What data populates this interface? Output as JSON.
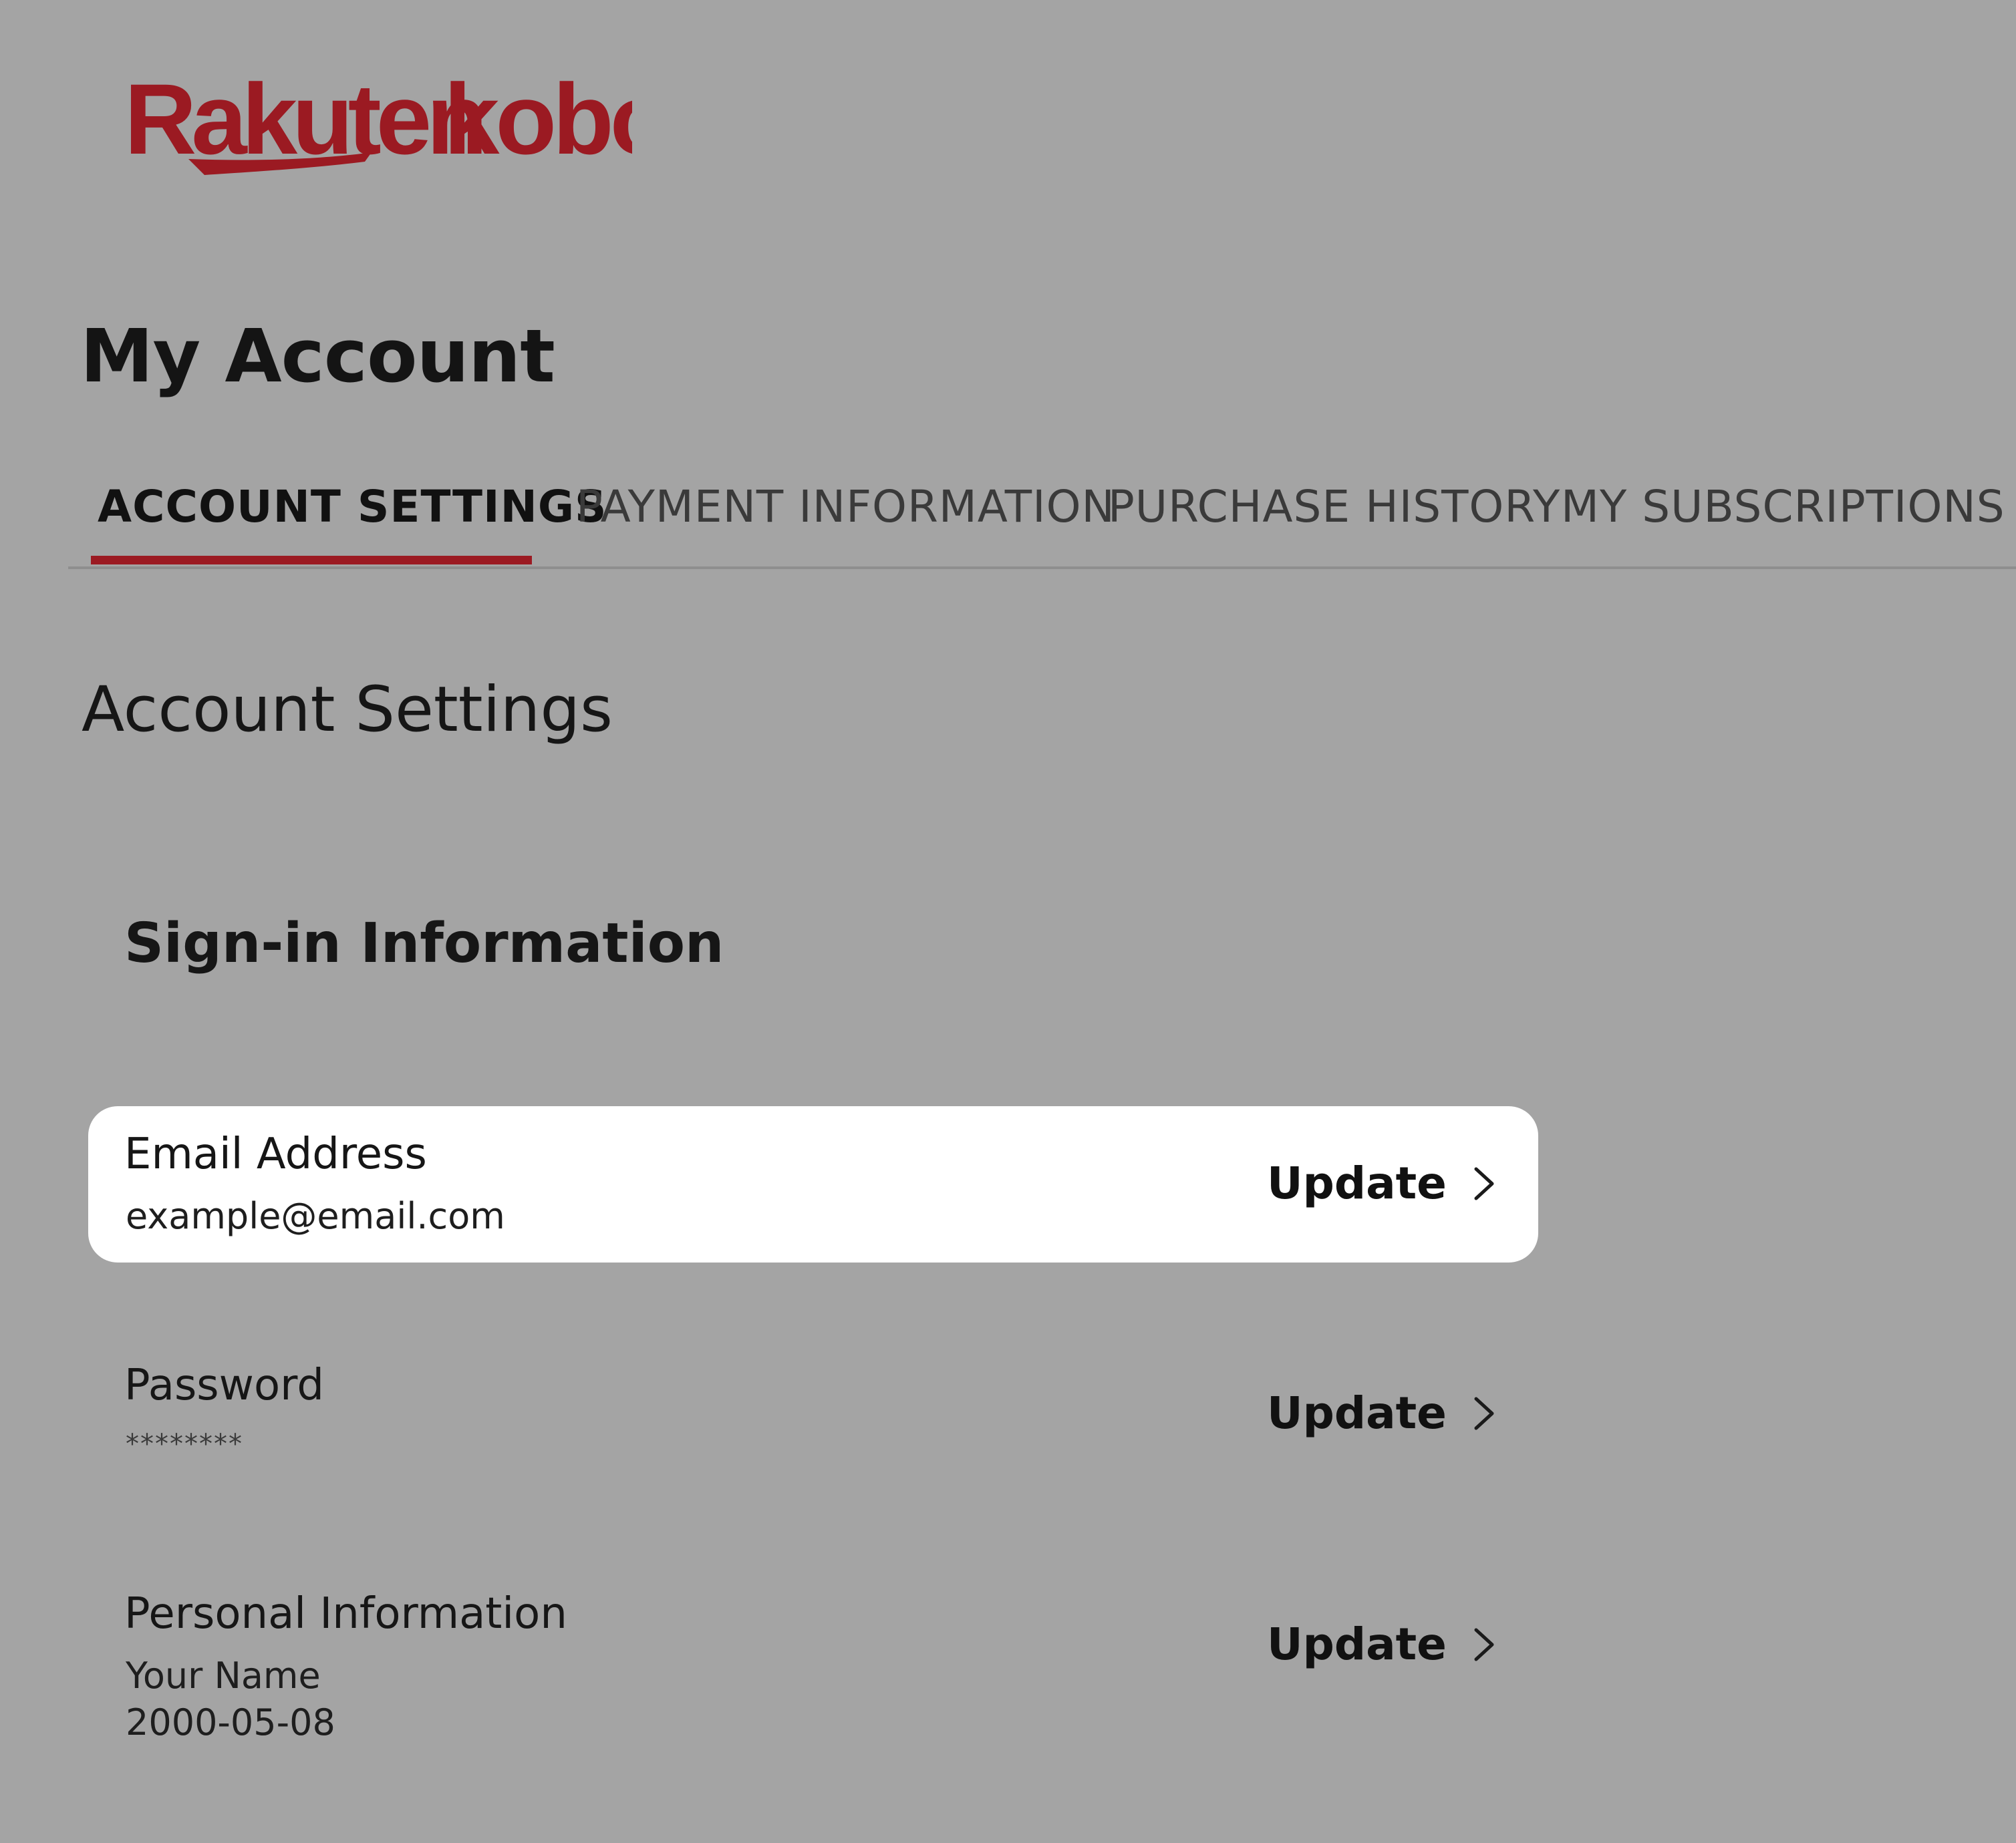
{
  "brand": {
    "logo_text": "Rakuten kobo",
    "logo_color": "#9b1a22"
  },
  "page": {
    "title": "My Account"
  },
  "tabs": [
    {
      "label": "ACCOUNT SETTINGS",
      "active": true
    },
    {
      "label": "PAYMENT INFORMATION",
      "active": false
    },
    {
      "label": "PURCHASE HISTORY",
      "active": false
    },
    {
      "label": "MY SUBSCRIPTIONS",
      "active": false
    }
  ],
  "section": {
    "title": "Account Settings",
    "group_title": "Sign-in Information"
  },
  "rows": [
    {
      "label": "Email Address",
      "value": "example@email.com",
      "action": "Update",
      "action_icon": "chevron-right-icon",
      "highlighted": true
    },
    {
      "label": "Password",
      "value": "********",
      "action": "Update",
      "action_icon": "chevron-right-icon",
      "highlighted": false
    },
    {
      "label": "Personal Information",
      "value": "Your Name",
      "value2": "2000-05-08",
      "action": "Update",
      "action_icon": "chevron-right-icon",
      "highlighted": false
    }
  ],
  "colors": {
    "background": "#a4a4a4",
    "accent": "#9b1a22",
    "card": "#ffffff"
  }
}
